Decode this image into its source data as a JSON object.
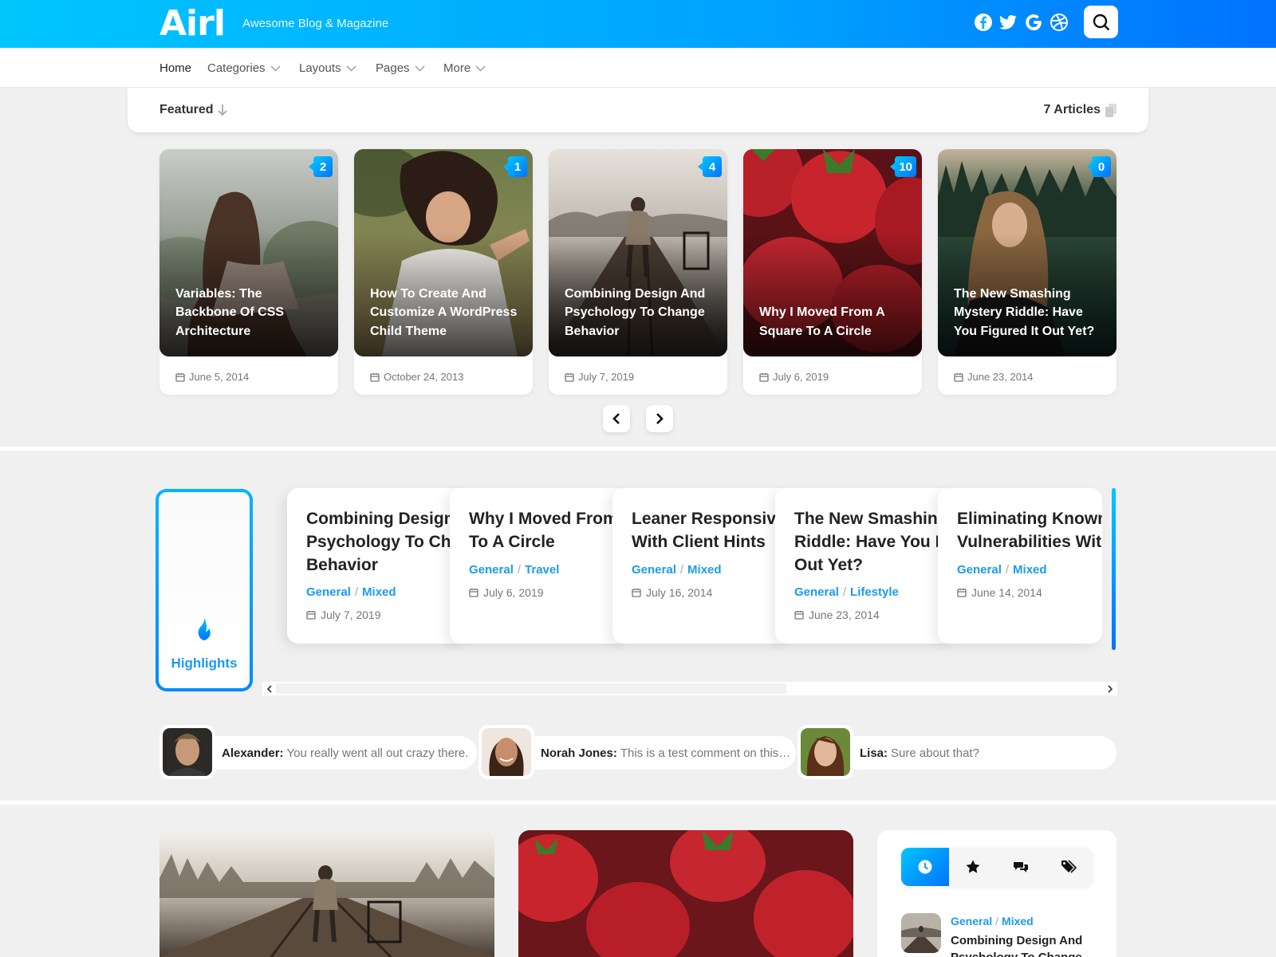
{
  "header": {
    "logo": "Airl",
    "tagline": "Awesome Blog & Magazine",
    "social_icons": [
      "facebook-icon",
      "twitter-icon",
      "google-icon",
      "dribbble-icon"
    ],
    "search_icon": "search-icon",
    "colors": {
      "gradient_start": "#00c6ff",
      "gradient_end": "#0072ff",
      "accent": "#1a9bf0"
    }
  },
  "nav": {
    "items": [
      {
        "label": "Home",
        "dropdown": false
      },
      {
        "label": "Categories",
        "dropdown": true
      },
      {
        "label": "Layouts",
        "dropdown": true
      },
      {
        "label": "Pages",
        "dropdown": true
      },
      {
        "label": "More",
        "dropdown": true
      }
    ]
  },
  "featured": {
    "label": "Featured",
    "count": "7 Articles",
    "cards": [
      {
        "title": "Variables: The Backbone Of CSS Architecture",
        "date": "June 5, 2014",
        "comments": "2"
      },
      {
        "title": "How To Create And Customize A WordPress Child Theme",
        "date": "October 24, 2013",
        "comments": "1"
      },
      {
        "title": "Combining Design And Psychology To Change Behavior",
        "date": "July 7, 2019",
        "comments": "4"
      },
      {
        "title": "Why I Moved From A Square To A Circle",
        "date": "July 6, 2019",
        "comments": "10"
      },
      {
        "title": "The New Smashing Mystery Riddle: Have You Figured It Out Yet?",
        "date": "June 23, 2014",
        "comments": "0"
      }
    ]
  },
  "highlights": {
    "label": "Highlights",
    "cards": [
      {
        "title_lines": [
          "Combining Design",
          "Psychology To Cha",
          "Behavior"
        ],
        "cat1": "General",
        "cat2": "Mixed",
        "date": "July 7, 2019"
      },
      {
        "title_lines": [
          "Why I Moved From",
          "To A Circle"
        ],
        "cat1": "General",
        "cat2": "Travel",
        "date": "July 6, 2019"
      },
      {
        "title_lines": [
          "Leaner Responsive",
          "With Client Hints"
        ],
        "cat1": "General",
        "cat2": "Mixed",
        "date": "July 16, 2014"
      },
      {
        "title_lines": [
          "The New Smashing",
          "Riddle: Have You F",
          "Out Yet?"
        ],
        "cat1": "General",
        "cat2": "Lifestyle",
        "date": "June 23, 2014"
      },
      {
        "title_lines": [
          "Eliminating Known",
          "Vulnerabilities Wit"
        ],
        "cat1": "General",
        "cat2": "Mixed",
        "date": "June 14, 2014"
      }
    ]
  },
  "comments": [
    {
      "author": "Alexander:",
      "text": "You really went all out crazy there."
    },
    {
      "author": "Norah Jones:",
      "text": "This is a test comment on this…"
    },
    {
      "author": "Lisa:",
      "text": "Sure about that?"
    }
  ],
  "widget": {
    "tabs": [
      "clock-icon",
      "star-icon",
      "comments-icon",
      "tags-icon"
    ],
    "active_tab": 0,
    "post": {
      "cat1": "General",
      "cat2": "Mixed",
      "title": "Combining Design And Psychology To Change"
    }
  }
}
